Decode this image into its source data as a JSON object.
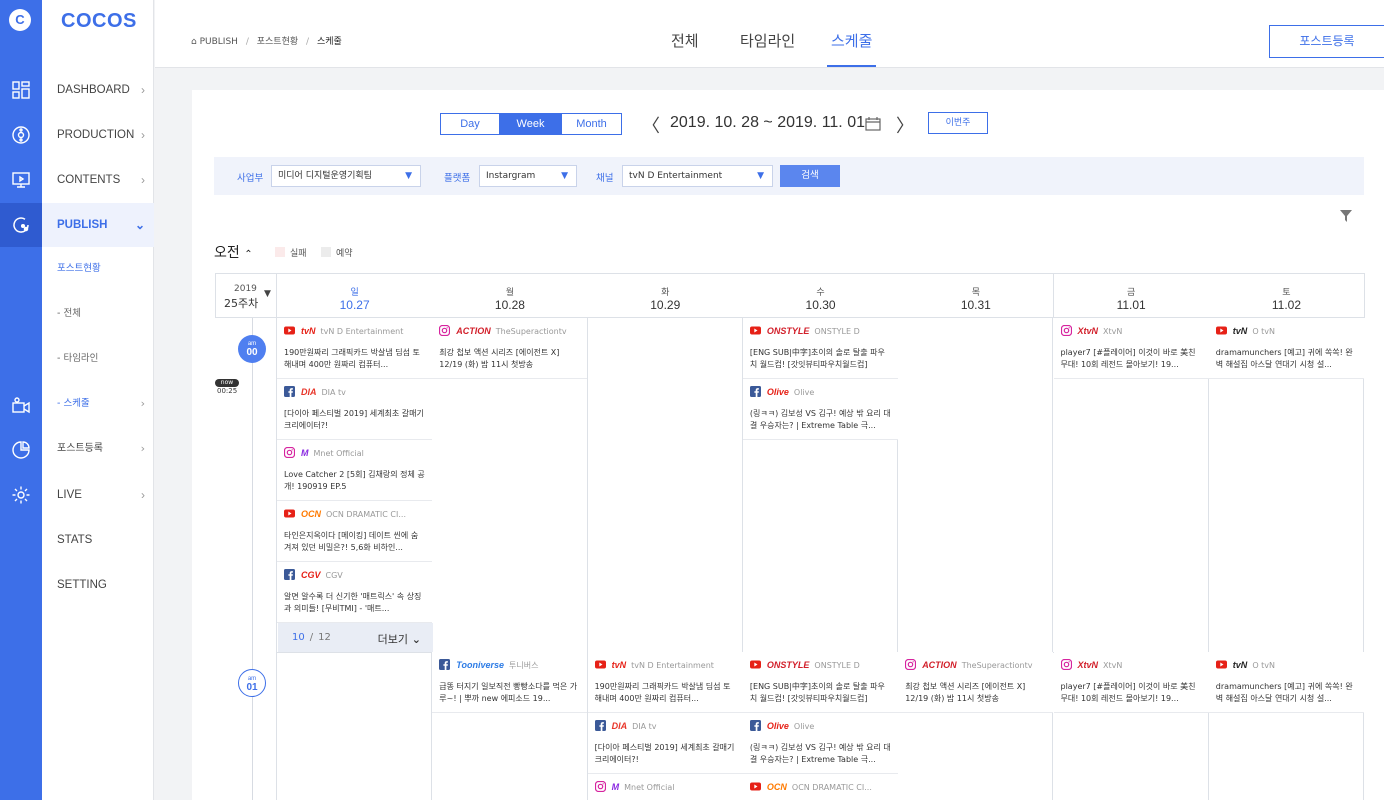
{
  "app": {
    "brand": "COCOS",
    "logo_letter": "C"
  },
  "rail_icons": [
    "dashboard-icon",
    "production-icon",
    "contents-icon",
    "publish-icon",
    "live-icon",
    "stats-icon",
    "setting-icon"
  ],
  "menu": {
    "items": [
      {
        "label": "DASHBOARD",
        "chevron": "›"
      },
      {
        "label": "PRODUCTION",
        "chevron": "›"
      },
      {
        "label": "CONTENTS",
        "chevron": "›"
      },
      {
        "label": "PUBLISH",
        "chevron": "⌄"
      },
      {
        "label": "포스트현황"
      },
      {
        "label": "- 전체"
      },
      {
        "label": "- 타임라인"
      },
      {
        "label": "- 스케줄",
        "chevron": "›"
      },
      {
        "label": "포스트등록",
        "chevron": "›"
      },
      {
        "label": "LIVE",
        "chevron": "›"
      },
      {
        "label": "STATS"
      },
      {
        "label": "SETTING"
      }
    ]
  },
  "breadcrumb": {
    "home": "PUBLISH",
    "mid": "포스트현황",
    "current": "스케줄",
    "sep": "/"
  },
  "tabs": [
    "전체",
    "타임라인",
    "스케줄"
  ],
  "register_button": "포스트등록",
  "view": {
    "day": "Day",
    "week": "Week",
    "month": "Month",
    "selected": "Week"
  },
  "range": {
    "text": "2019. 10. 28 ~ 2019. 11. 01",
    "prev": "〈",
    "next": "〉",
    "this_week": "이번주"
  },
  "filters": {
    "division_label": "사업부",
    "division_value": "미디어 디지털운영기획팀",
    "platform_label": "플랫폼",
    "platform_value": "Instargram",
    "channel_label": "채널",
    "channel_value": "tvN D Entertainment",
    "search": "검색"
  },
  "period": {
    "label": "오전",
    "toggle": "⌃",
    "legend_fail": "실패",
    "legend_reserve": "예약"
  },
  "week": {
    "year": "2019",
    "label": "25주차"
  },
  "days": [
    {
      "dow": "일",
      "date": "10.27",
      "today": true
    },
    {
      "dow": "월",
      "date": "10.28"
    },
    {
      "dow": "화",
      "date": "10.29"
    },
    {
      "dow": "수",
      "date": "10.30"
    },
    {
      "dow": "목",
      "date": "10.31"
    },
    {
      "dow": "금",
      "date": "11.01"
    },
    {
      "dow": "토",
      "date": "11.02"
    }
  ],
  "timeline": {
    "now_label": "now",
    "now_time": "00:25",
    "hours": [
      {
        "ampm": "am",
        "hour": "00"
      },
      {
        "ampm": "am",
        "hour": "01"
      }
    ]
  },
  "more": {
    "shown": "10",
    "total": "12",
    "label": "더보기",
    "sep": "/"
  },
  "colors": {
    "accent": "#3d6fe8",
    "youtube": "#e62117",
    "facebook": "#3b5998",
    "instagram": "#d6249f"
  },
  "slots": [
    {
      "columns": [
        [
          {
            "platform": "youtube",
            "brand": "tvN",
            "brand_color": "#e62117",
            "channel": "tvN D Entertainment",
            "title": "190만원짜리 그래픽카드 박살냄 딤섬 토해내며 400만 원짜리 컴퓨터..."
          },
          {
            "platform": "facebook",
            "brand": "DIA",
            "brand_color": "#e8362a",
            "channel": "DIA tv",
            "title": "[다이아 페스티벌 2019] 세계최초 갈매기 크리에이터?!"
          },
          {
            "platform": "instagram",
            "brand": "M",
            "brand_color": "#8b2be2",
            "channel": "Mnet Official",
            "title": "Love Catcher 2 [5회] 김채랑의 정체 공개! 190919 EP.5"
          },
          {
            "platform": "youtube",
            "brand": "OCN",
            "brand_color": "#ff7a00",
            "channel": "OCN DRAMATIC CI...",
            "title": "타인은지옥이다 [메이킹] 데이트 씬에 숨겨져 있던 비밀은?! 5,6화 비하인..."
          },
          {
            "platform": "facebook",
            "brand": "CGV",
            "brand_color": "#e62117",
            "channel": "CGV",
            "title": "알면 알수록 더 신기한 '매트릭스' 속 상징과 의미들! [무비TMI] - '매트..."
          }
        ],
        [
          {
            "platform": "instagram",
            "brand": "ACTION",
            "brand_color": "#d21f2a",
            "channel": "TheSuperactiontv",
            "title": "최강 첩보 액션 시리즈 [에이전트 X] 12/19 (화) 밤 11시 첫방송"
          }
        ],
        [],
        [
          {
            "platform": "youtube",
            "brand": "ONSTYLE",
            "brand_color": "#d21f2a",
            "channel": "ONSTYLE D",
            "title": "[ENG SUB|中字]초이의 솔로 탈출 파우치 월드컵! [갓잇뷰티파우치월드컵]"
          },
          {
            "platform": "facebook",
            "brand": "Olive",
            "brand_color": "#e62117",
            "channel": "Olive",
            "title": "(링ㅋㅋ) 김보성 VS 김구! 예상 밖 요리 대결 우승자는? | Extreme Table 극..."
          }
        ],
        [],
        [
          {
            "platform": "instagram",
            "brand": "XtvN",
            "brand_color": "#d21f2a",
            "channel": "XtvN",
            "title": "player7 [#플레이어] 이것이 바로 美친 무대! 10회 레전드 몰아보기! 19..."
          }
        ],
        [
          {
            "platform": "youtube",
            "brand": "tvN",
            "brand_color": "#222222",
            "channel": "O tvN",
            "title": "dramamunchers [예고] 귀에 쏙쏙! 완벽 해설집 아스달 연대기 시청 설..."
          }
        ]
      ]
    },
    {
      "columns": [
        [],
        [
          {
            "platform": "facebook",
            "brand": "Tooniverse",
            "brand_color": "#2c7be5",
            "channel": "투니버스",
            "title": "급똥 터지기 일보직전 빵빵소다를 먹은 가루~! | 뿌까 new 에피소드 19..."
          }
        ],
        [
          {
            "platform": "youtube",
            "brand": "tvN",
            "brand_color": "#e62117",
            "channel": "tvN D Entertainment",
            "title": "190만원짜리 그래픽카드 박살냄 딤섬 토해내며 400만 원짜리 컴퓨터..."
          },
          {
            "platform": "facebook",
            "brand": "DIA",
            "brand_color": "#e8362a",
            "channel": "DIA tv",
            "title": "[다이아 페스티벌 2019] 세계최초 갈매기 크리에이터?!"
          },
          {
            "platform": "instagram",
            "brand": "M",
            "brand_color": "#8b2be2",
            "channel": "Mnet Official",
            "title": ""
          }
        ],
        [
          {
            "platform": "youtube",
            "brand": "ONSTYLE",
            "brand_color": "#d21f2a",
            "channel": "ONSTYLE D",
            "title": "[ENG SUB|中字]초이의 솔로 탈출 파우치 월드컵! [갓잇뷰티파우치월드컵]"
          },
          {
            "platform": "facebook",
            "brand": "Olive",
            "brand_color": "#e62117",
            "channel": "Olive",
            "title": "(링ㅋㅋ) 김보성 VS 김구! 예상 밖 요리 대결 우승자는? | Extreme Table 극..."
          },
          {
            "platform": "youtube",
            "brand": "OCN",
            "brand_color": "#ff7a00",
            "channel": "OCN DRAMATIC CI...",
            "title": ""
          }
        ],
        [
          {
            "platform": "instagram",
            "brand": "ACTION",
            "brand_color": "#d21f2a",
            "channel": "TheSuperactiontv",
            "title": "최강 첩보 액션 시리즈 [에이전트 X] 12/19 (화) 밤 11시 첫방송"
          }
        ],
        [
          {
            "platform": "instagram",
            "brand": "XtvN",
            "brand_color": "#d21f2a",
            "channel": "XtvN",
            "title": "player7 [#플레이어] 이것이 바로 美친 무대! 10회 레전드 몰아보기! 19..."
          }
        ],
        [
          {
            "platform": "youtube",
            "brand": "tvN",
            "brand_color": "#222222",
            "channel": "O tvN",
            "title": "dramamunchers [예고] 귀에 쏙쏙! 완벽 해설집 아스달 연대기 시청 설..."
          }
        ]
      ]
    }
  ]
}
